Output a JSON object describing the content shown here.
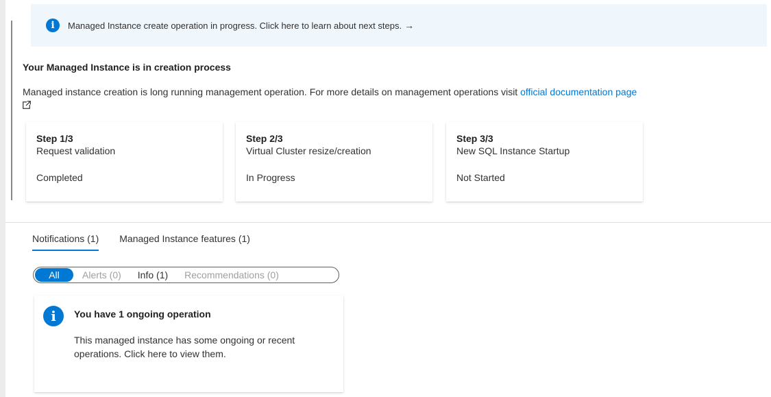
{
  "banner": {
    "text": "Managed Instance create operation in progress. Click here to learn about next steps.",
    "arrow": "→"
  },
  "creation": {
    "title": "Your Managed Instance is in creation process",
    "description": "Managed instance creation is long running management operation. For more details on management operations visit ",
    "link_text": "official documentation page"
  },
  "steps": [
    {
      "number": "Step 1/3",
      "name": "Request validation",
      "status": "Completed"
    },
    {
      "number": "Step 2/3",
      "name": "Virtual Cluster resize/creation",
      "status": "In Progress"
    },
    {
      "number": "Step 3/3",
      "name": "New SQL Instance Startup",
      "status": "Not Started"
    }
  ],
  "tabs": [
    {
      "label": "Notifications (1)",
      "active": true
    },
    {
      "label": "Managed Instance features (1)",
      "active": false
    }
  ],
  "filters": [
    {
      "label": "All",
      "active": true
    },
    {
      "label": "Alerts (0)",
      "active": false
    },
    {
      "label": "Info (1)",
      "active": false
    },
    {
      "label": "Recommendations (0)",
      "active": false
    }
  ],
  "notification": {
    "title": "You have 1 ongoing operation",
    "body": "This managed instance has some ongoing or recent operations. Click here to view them."
  },
  "icons": {
    "info": "info-icon",
    "external_link": "external-link-icon"
  },
  "colors": {
    "accent": "#0078d4",
    "banner_bg": "#eff6fc"
  }
}
